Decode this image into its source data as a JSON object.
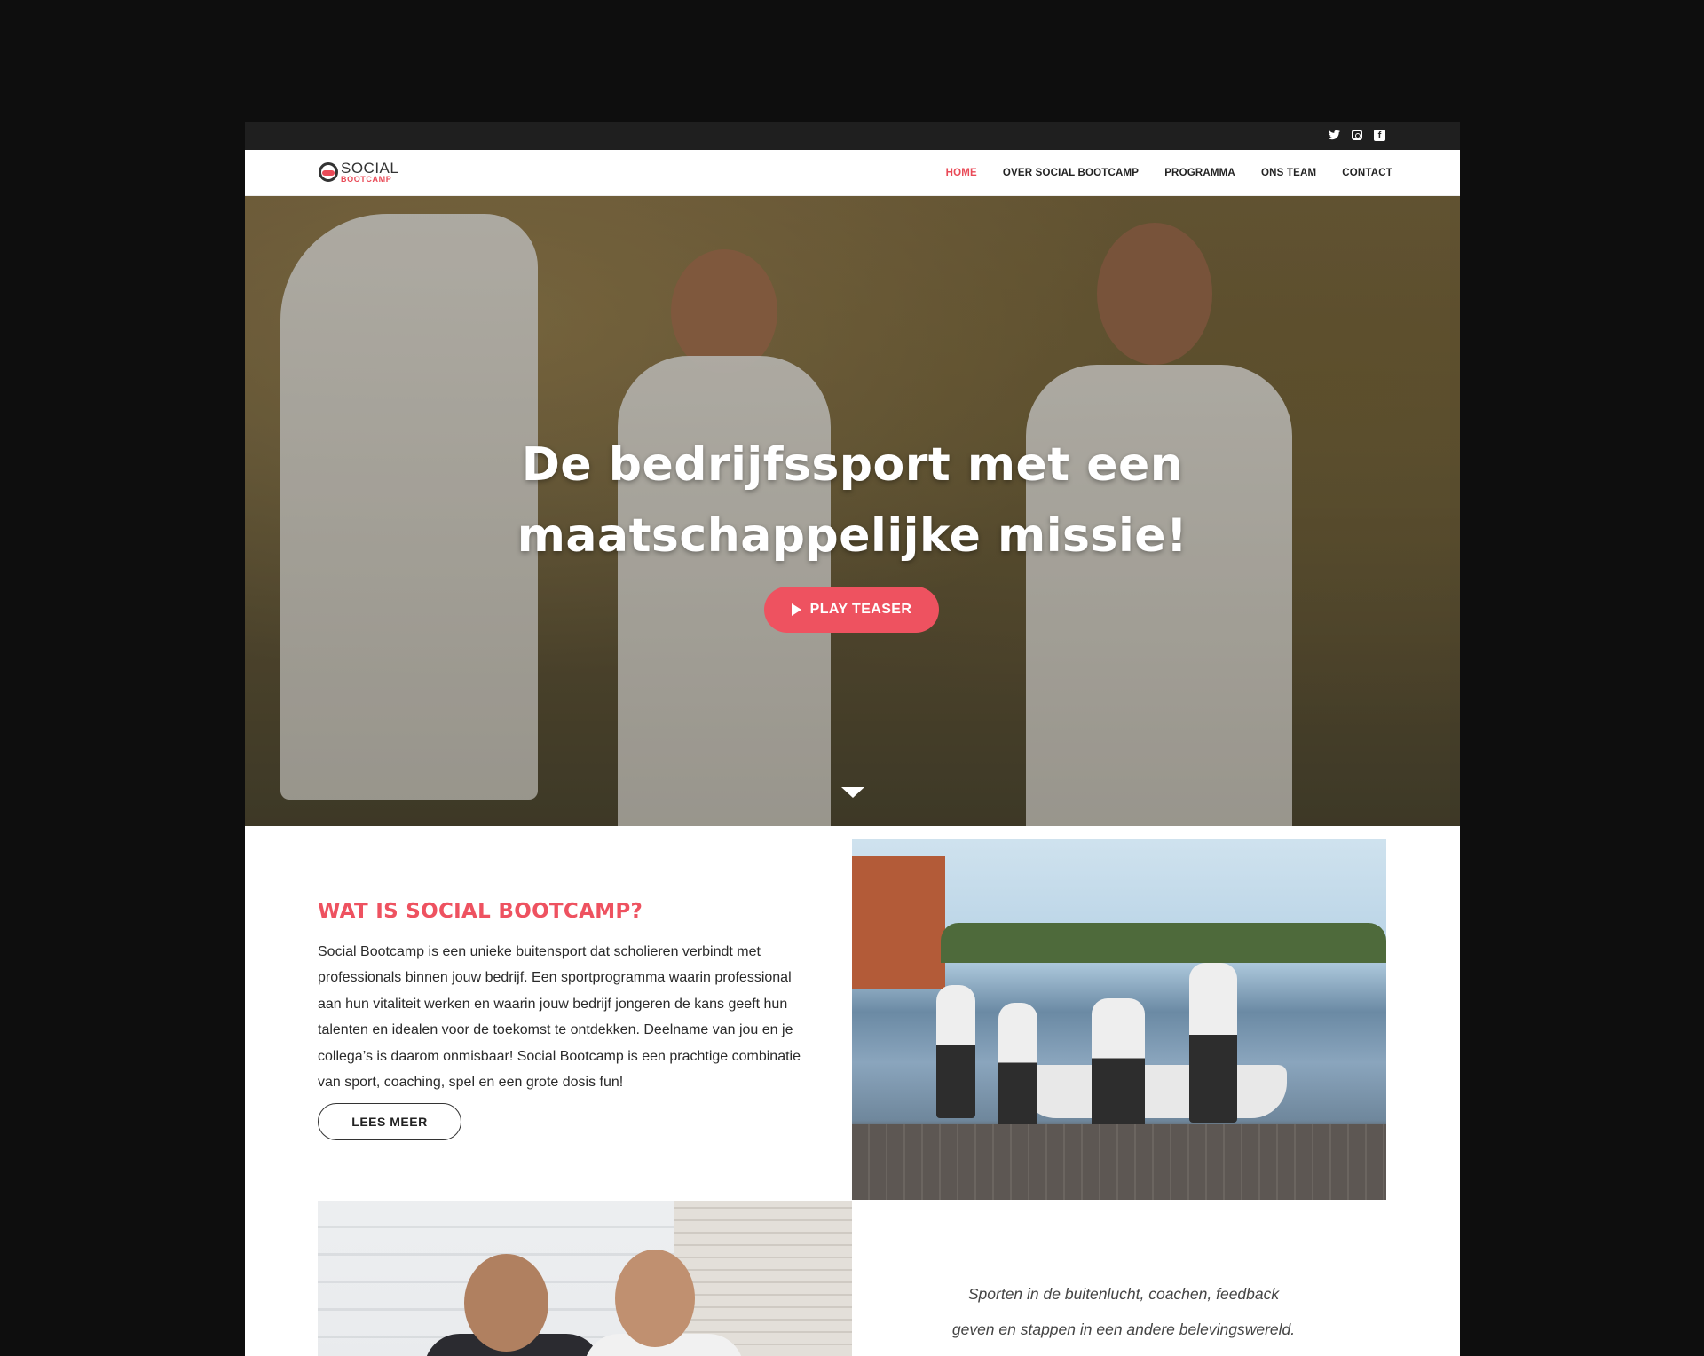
{
  "topbar": {
    "icons": [
      "twitter-icon",
      "instagram-icon",
      "facebook-icon"
    ]
  },
  "nav": {
    "logo_top": "SOCIAL",
    "logo_bottom": "BOOTCAMP",
    "items": [
      {
        "label": "HOME",
        "active": true
      },
      {
        "label": "OVER SOCIAL BOOTCAMP",
        "active": false
      },
      {
        "label": "PROGRAMMA",
        "active": false
      },
      {
        "label": "ONS TEAM",
        "active": false
      },
      {
        "label": "CONTACT",
        "active": false
      }
    ]
  },
  "hero": {
    "title_line1": "De bedrijfssport met een",
    "title_line2": "maatschappelijke missie!",
    "button_label": "PLAY TEASER"
  },
  "intro": {
    "title": "WAT IS SOCIAL BOOTCAMP?",
    "text": "Social Bootcamp is een unieke buitensport dat scholieren verbindt met professionals binnen jouw bedrijf. Een sportprogramma waarin professional aan hun vitaliteit werken en waarin jouw bedrijf jongeren de kans geeft hun talenten en idealen voor de toekomst te ontdekken. Deelname van jou en je collega’s is daarom onmisbaar! Social Bootcamp is een prachtige combinatie van sport, coaching, spel en een grote dosis fun!",
    "button_label": "LEES MEER"
  },
  "quote": {
    "line1": "Sporten in de buitenlucht, coachen, feedback",
    "line2": "geven en stappen in een andere belevingswereld."
  },
  "colors": {
    "accent": "#ee5260",
    "topbar": "#1f1f1f",
    "page_bg": "#0e0e0e"
  }
}
